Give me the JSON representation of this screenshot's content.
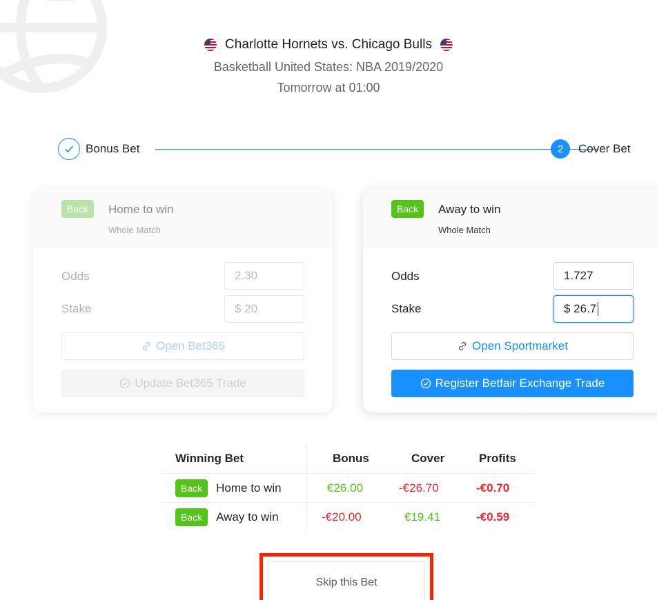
{
  "header": {
    "title": "Charlotte Hornets vs. Chicago Bulls",
    "subtitle": "Basketball United States: NBA 2019/2020",
    "time": "Tomorrow at 01:00"
  },
  "steps": {
    "step1_label": "Bonus Bet",
    "step2_number": "2",
    "step2_label": "Cover Bet"
  },
  "bonus_card": {
    "badge": "Back",
    "selection": "Home to win",
    "market": "Whole Match",
    "odds_label": "Odds",
    "odds_value": "2.30",
    "stake_label": "Stake",
    "stake_value": "$ 20",
    "open_button": "Open Bet365",
    "update_button": "Update Bet365 Trade"
  },
  "cover_card": {
    "badge": "Back",
    "selection": "Away to win",
    "market": "Whole Match",
    "odds_label": "Odds",
    "odds_value": "1.727",
    "stake_label": "Stake",
    "stake_value": "$ 26.7",
    "open_button": "Open Sportmarket",
    "register_button": "Register Betfair Exchange Trade"
  },
  "table": {
    "headers": [
      "Winning Bet",
      "Bonus",
      "Cover",
      "Profits"
    ],
    "rows": [
      {
        "badge": "Back",
        "bet": "Home to win",
        "bonus": "€26.00",
        "cover": "-€26.70",
        "profit": "-€0.70"
      },
      {
        "badge": "Back",
        "bet": "Away to win",
        "bonus": "-€20.00",
        "cover": "€19.41",
        "profit": "-€0.59"
      }
    ]
  },
  "skip_button": "Skip this Bet",
  "colors": {
    "primary": "#1890ff",
    "success": "#52c41a",
    "danger": "#f5222d",
    "highlight_box": "#ff2200"
  }
}
